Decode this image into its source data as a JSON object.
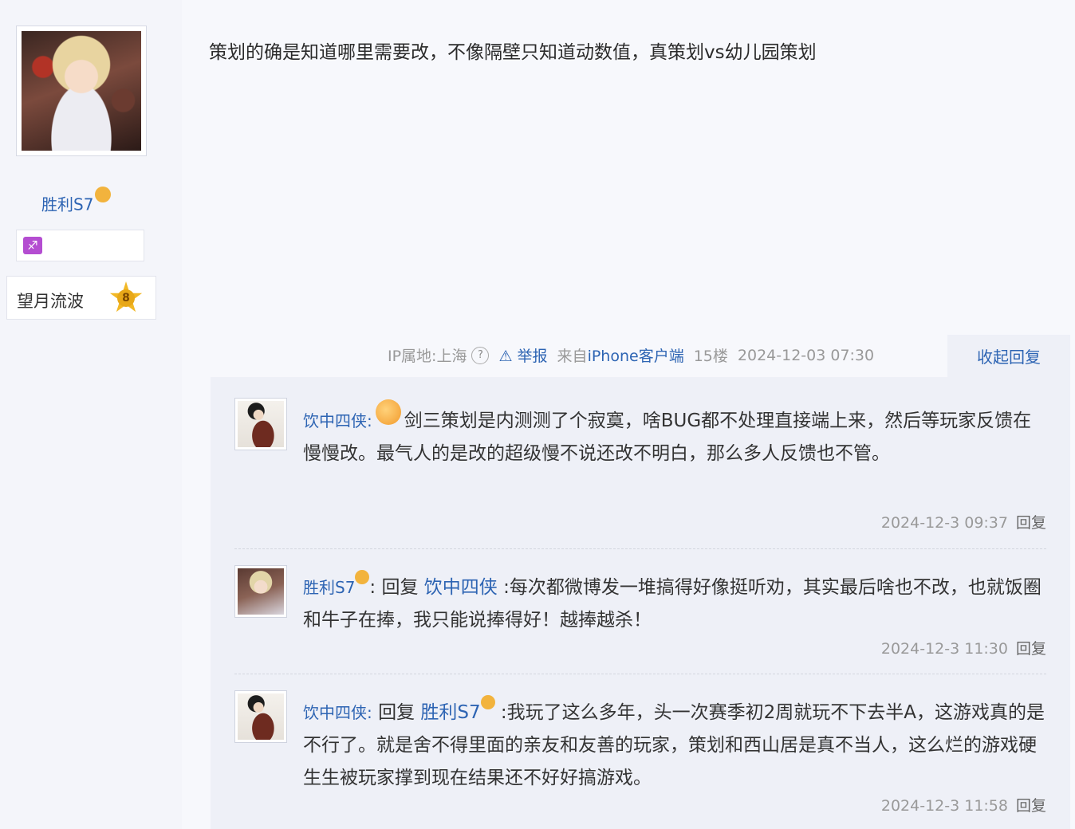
{
  "author": {
    "name": "胜利S7",
    "level_title": "望月流波",
    "level": "8",
    "zodiac_symbol": "♐"
  },
  "post": {
    "content": "策划的确是知道哪里需要改，不像隔壁只知道动数值，真策划vs幼儿园策划",
    "ip_location": "IP属地:上海",
    "help_symbol": "?",
    "report_label": "⚠ 举报",
    "client_prefix": "来自",
    "client_name": "iPhone客户端",
    "floor": "15楼",
    "time": "2024-12-03 07:30",
    "collapse_label": "收起回复"
  },
  "replies": [
    {
      "user": "饮中四侠:",
      "text": "剑三策划是内测测了个寂寞，啥BUG都不处理直接端上来，然后等玩家反馈在慢慢改。最气人的是改的超级慢不说还改不明白，那么多人反馈也不管。",
      "time": "2024-12-3 09:37",
      "reply_label": "回复"
    },
    {
      "user": "胜利S7",
      "reply_word": "回复",
      "target": "饮中四侠",
      "text": ":每次都微博发一堆搞得好像挺听劝，其实最后啥也不改，也就饭圈和牛子在捧，我只能说捧得好！越捧越杀！",
      "time": "2024-12-3 11:30",
      "reply_label": "回复"
    },
    {
      "user": "饮中四侠:",
      "reply_word": "回复",
      "target": "胜利S7",
      "text": ":我玩了这么多年，头一次赛季初2周就玩不下去半A，这游戏真的是不行了。就是舍不得里面的亲友和友善的玩家，策划和西山居是真不当人，这么烂的游戏硬生生被玩家撑到现在结果还不好好搞游戏。",
      "time": "2024-12-3 11:58",
      "reply_label": "回复"
    }
  ]
}
